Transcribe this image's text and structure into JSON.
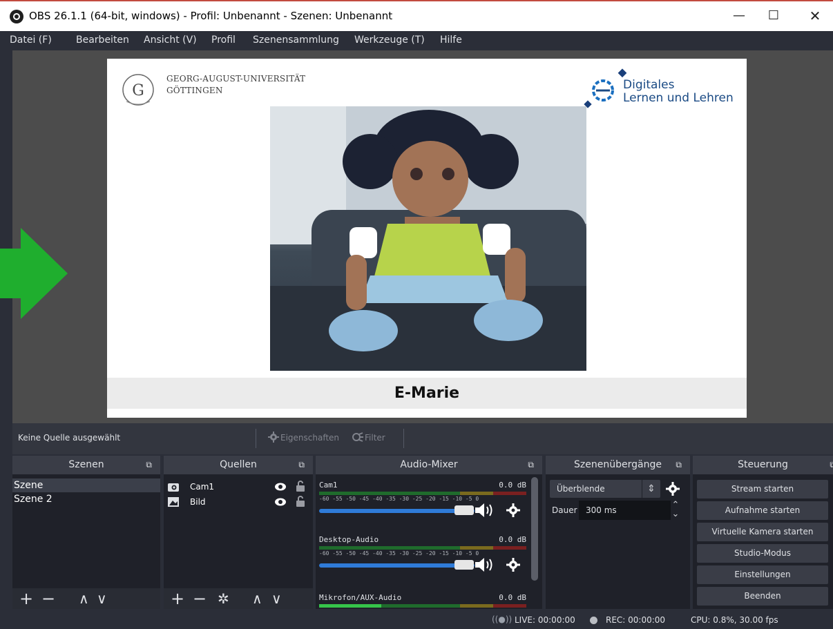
{
  "window": {
    "title": "OBS 26.1.1 (64-bit, windows) - Profil: Unbenannt - Szenen: Unbenannt",
    "minimize": "—",
    "maximize": "☐",
    "close": "✕"
  },
  "menu": [
    "Datei (F)",
    "Bearbeiten",
    "Ansicht (V)",
    "Profil",
    "Szenensammlung",
    "Werkzeuge (T)",
    "Hilfe"
  ],
  "preview": {
    "university_line1": "GEORG-AUGUST-UNIVERSITÄT",
    "university_line2": "GÖTTINGEN",
    "dll_line1": "Digitales",
    "dll_line2": "Lernen und Lehren",
    "caption": "E-Marie"
  },
  "source_toolbar": {
    "no_source": "Keine Quelle ausgewählt",
    "properties": "Eigenschaften",
    "filter": "Filter"
  },
  "docks": {
    "scenes": {
      "title": "Szenen",
      "items": [
        "Szene",
        "Szene 2"
      ],
      "selected": 0
    },
    "sources": {
      "title": "Quellen",
      "items": [
        "Cam1",
        "Bild"
      ]
    },
    "mixer": {
      "title": "Audio-Mixer",
      "channels": [
        {
          "name": "Cam1",
          "db": "0.0 dB"
        },
        {
          "name": "Desktop-Audio",
          "db": "0.0 dB"
        },
        {
          "name": "Mikrofon/AUX-Audio",
          "db": "0.0 dB"
        }
      ],
      "ticks": "-60 -55 -50 -45 -40 -35 -30 -25 -20 -15 -10 -5 0"
    },
    "transitions": {
      "title": "Szenenübergänge",
      "selected": "Überblende",
      "duration_label": "Dauer",
      "duration_value": "300 ms"
    },
    "controls": {
      "title": "Steuerung",
      "buttons": [
        "Stream starten",
        "Aufnahme starten",
        "Virtuelle Kamera starten",
        "Studio-Modus",
        "Einstellungen",
        "Beenden"
      ]
    }
  },
  "status": {
    "live": "LIVE: 00:00:00",
    "rec": "REC: 00:00:00",
    "cpu": "CPU: 0.8%, 30.00 fps"
  },
  "icons": {
    "arrow": "green-arrow-icon",
    "gear": "gear-icon",
    "eye": "eye-icon",
    "lock": "lock-icon",
    "volume": "speaker-icon"
  },
  "colors": {
    "arrow": "#1fae2e",
    "fader": "#2f7bd8",
    "dock_bg": "#1f2129",
    "header_bg": "#3a3d47"
  }
}
